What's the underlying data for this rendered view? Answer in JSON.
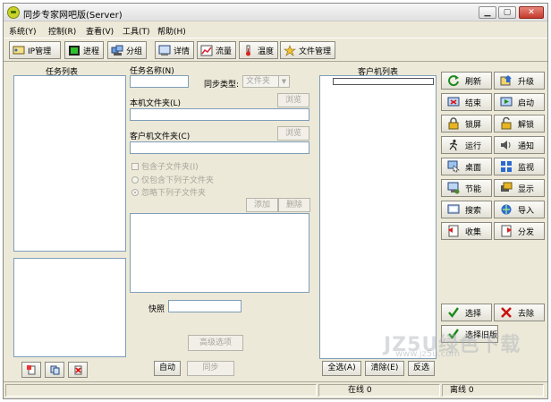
{
  "window": {
    "title": "同步专家网吧版(Server)",
    "minimize": "0",
    "maximize": "1",
    "close": "r"
  },
  "menu": [
    "系统(Y)",
    "控制(R)",
    "查看(V)",
    "工具(T)",
    "帮助(H)"
  ],
  "toolbar": {
    "ip": "IP管理",
    "process": "进程",
    "group": "分组",
    "detail": "详情",
    "traffic": "流量",
    "temperature": "温度",
    "file_manage": "文件管理"
  },
  "left_panel": {
    "task_list_label": "任务列表"
  },
  "middle_panel": {
    "task_name_label": "任务名称(N)",
    "sync_type_label": "同步类型:",
    "sync_type_value": "文件夹",
    "local_folder_label": "本机文件夹(L)",
    "browse_local": "浏览",
    "client_folder_label": "客户机文件夹(C)",
    "browse_client": "浏览",
    "include_subfolders": "包含子文件夹(I)",
    "only_include_sub": "仅包含下列子文件夹",
    "ignore_sub": "忽略下列子文件夹",
    "add": "添加",
    "delete": "删除",
    "snapshot_label": "快照",
    "advanced": "高级选项",
    "auto": "自动",
    "sync": "同步"
  },
  "client_panel": {
    "label": "客户机列表",
    "select_all": "全选(A)",
    "clear": "清除(E)",
    "invert": "反选"
  },
  "right_buttons": [
    {
      "label": "刷新",
      "icon": "refresh-icon"
    },
    {
      "label": "升级",
      "icon": "upgrade-icon"
    },
    {
      "label": "结束",
      "icon": "end-icon"
    },
    {
      "label": "启动",
      "icon": "start-icon"
    },
    {
      "label": "锁屏",
      "icon": "lock-icon"
    },
    {
      "label": "解锁",
      "icon": "unlock-icon"
    },
    {
      "label": "运行",
      "icon": "run-icon"
    },
    {
      "label": "通知",
      "icon": "speaker-icon"
    },
    {
      "label": "桌面",
      "icon": "desktop-icon"
    },
    {
      "label": "监视",
      "icon": "monitor-icon"
    },
    {
      "label": "节能",
      "icon": "energy-icon"
    },
    {
      "label": "显示",
      "icon": "display-icon"
    },
    {
      "label": "搜索",
      "icon": "search-icon"
    },
    {
      "label": "导入",
      "icon": "import-icon"
    },
    {
      "label": "收集",
      "icon": "collect-icon"
    },
    {
      "label": "分发",
      "icon": "distribute-icon"
    }
  ],
  "select_button": "选择",
  "remove_button": "去除",
  "select_old_button": "选择旧版",
  "status": {
    "online": "在线 0",
    "offline": "离线 0"
  },
  "watermark": {
    "main": "JZ5U绿色下载",
    "sub": "www.jz5u.com"
  }
}
